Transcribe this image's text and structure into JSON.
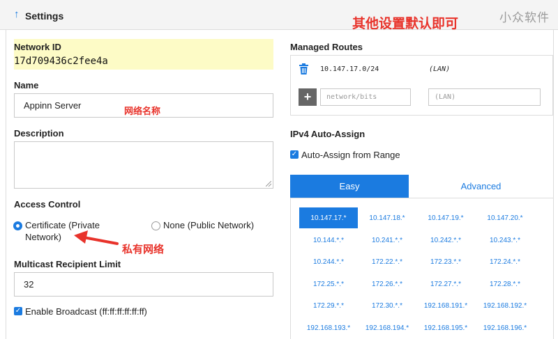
{
  "header": {
    "title": "Settings",
    "watermark": "小众软件"
  },
  "annotations": {
    "top": "其他设置默认即可",
    "name": "网络名称",
    "private": "私有网络"
  },
  "network_id": {
    "label": "Network ID",
    "value": "17d709436c2fee4a"
  },
  "name": {
    "label": "Name",
    "value": "Appinn Server"
  },
  "description": {
    "label": "Description",
    "value": ""
  },
  "access_control": {
    "label": "Access Control",
    "options": [
      {
        "line1": "Certificate (Private",
        "line2": "Network)",
        "selected": true
      },
      {
        "line1": "None (Public Network)",
        "line2": "",
        "selected": false
      }
    ]
  },
  "multicast": {
    "label": "Multicast Recipient Limit",
    "value": "32"
  },
  "broadcast": {
    "label": "Enable Broadcast (ff:ff:ff:ff:ff:ff)",
    "checked": true
  },
  "managed_routes": {
    "label": "Managed Routes",
    "routes": [
      {
        "target": "10.147.17.0/24",
        "via": "(LAN)"
      }
    ],
    "new_target_placeholder": "network/bits",
    "new_via_placeholder": "(LAN)"
  },
  "ipv4": {
    "label": "IPv4 Auto-Assign",
    "checkbox_label": "Auto-Assign from Range",
    "checked": true,
    "tabs": [
      "Easy",
      "Advanced"
    ],
    "active_tab": "Easy",
    "ranges": [
      "10.147.17.*",
      "10.147.18.*",
      "10.147.19.*",
      "10.147.20.*",
      "10.144.*.*",
      "10.241.*.*",
      "10.242.*.*",
      "10.243.*.*",
      "10.244.*.*",
      "172.22.*.*",
      "172.23.*.*",
      "172.24.*.*",
      "172.25.*.*",
      "172.26.*.*",
      "172.27.*.*",
      "172.28.*.*",
      "172.29.*.*",
      "172.30.*.*",
      "192.168.191.*",
      "192.168.192.*",
      "192.168.193.*",
      "192.168.194.*",
      "192.168.195.*",
      "192.168.196.*"
    ],
    "selected_range": "10.147.17.*"
  },
  "colors": {
    "accent": "#1b7be0",
    "highlight": "#fdfbc6",
    "annotation": "#e8332b"
  }
}
